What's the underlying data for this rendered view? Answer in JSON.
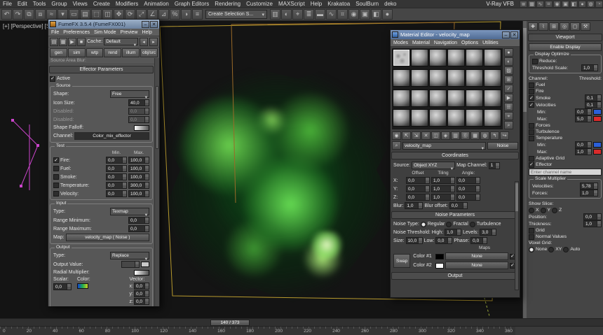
{
  "glyph_note": "icon glyphs are decorative approximations",
  "menu": {
    "items": [
      "File",
      "Edit",
      "Tools",
      "Group",
      "Views",
      "Create",
      "Modifiers",
      "Animation",
      "Graph Editors",
      "Rendering",
      "Customize",
      "MAXScript",
      "Help",
      "Krakatoa",
      "SoulBurn",
      "deko"
    ]
  },
  "vray_label": "V-Ray VFB",
  "top_right_icons": [
    {
      "name": "layer-manager-icon",
      "g": "≣"
    },
    {
      "name": "graphite-tools-icon",
      "g": "▦"
    },
    {
      "name": "curve-editor-icon",
      "g": "∿"
    },
    {
      "name": "schematic-view-icon",
      "g": "⌗"
    },
    {
      "name": "material-editor-icon",
      "g": "◉"
    },
    {
      "name": "render-setup-icon",
      "g": "▣"
    },
    {
      "name": "rendered-frame-window-icon",
      "g": "◧"
    },
    {
      "name": "render-production-icon",
      "g": "●"
    },
    {
      "name": "render-iterative-icon",
      "g": "◍"
    },
    {
      "name": "quick-render-icon",
      "g": "◔"
    }
  ],
  "toolbar": {
    "selection_set_value": "Create Selection S...",
    "icons": [
      {
        "name": "undo-icon",
        "g": "↶"
      },
      {
        "name": "redo-icon",
        "g": "↷"
      },
      {
        "name": "select-and-link-icon",
        "g": "⧉"
      },
      {
        "name": "unlink-selection-icon",
        "g": "⧈"
      },
      {
        "name": "bind-to-space-warp-icon",
        "g": "≈"
      },
      {
        "name": "selection-filter-icon",
        "g": "▾"
      },
      {
        "name": "select-object-icon",
        "g": "▭"
      },
      {
        "name": "select-by-name-icon",
        "g": "▤"
      },
      {
        "name": "selection-region-icon",
        "g": "⬚"
      },
      {
        "name": "window-crossing-icon",
        "g": "◫"
      },
      {
        "name": "select-and-move-icon",
        "g": "✥"
      },
      {
        "name": "select-and-rotate-icon",
        "g": "⟳"
      },
      {
        "name": "select-and-scale-icon",
        "g": "⤢"
      },
      {
        "name": "snaps-toggle-icon",
        "g": "∠"
      },
      {
        "name": "angle-snap-icon",
        "g": "⊿"
      },
      {
        "name": "percent-snap-icon",
        "g": "%"
      },
      {
        "name": "mirror-icon",
        "g": "◑"
      },
      {
        "name": "align-icon",
        "g": "≡"
      }
    ],
    "right_icons": [
      {
        "name": "named-selection-icon",
        "g": "▥"
      },
      {
        "name": "mirror-tool-icon",
        "g": "◐"
      },
      {
        "name": "align-tool-icon",
        "g": "⌖"
      },
      {
        "name": "layer-explorer-icon",
        "g": "≣"
      },
      {
        "name": "toggle-ribbon-icon",
        "g": "▬"
      },
      {
        "name": "curve-editor-toolbar-icon",
        "g": "∿"
      },
      {
        "name": "schematic-view-toolbar-icon",
        "g": "⌗"
      },
      {
        "name": "material-editor-toolbar-icon",
        "g": "◉"
      },
      {
        "name": "render-setup-toolbar-icon",
        "g": "▣"
      },
      {
        "name": "render-frame-icon",
        "g": "◧"
      },
      {
        "name": "render-teapot-icon",
        "g": "●"
      }
    ]
  },
  "viewport": {
    "label": "[+] [Perspective] [Shaded]"
  },
  "fume": {
    "title": "FumeFX 3.5.4 (FumeFX001)",
    "menus": [
      "File",
      "Preferences",
      "Sim Mode",
      "Preview",
      "Help"
    ],
    "tool_icons": [
      {
        "name": "open-icon",
        "g": "▤",
        "style": "background:#4e8f4e;color:#eaffea;"
      },
      {
        "name": "save-icon",
        "g": "▦"
      },
      {
        "name": "start-simulation-icon",
        "g": "▶"
      },
      {
        "name": "stop-simulation-icon",
        "g": "■"
      }
    ],
    "cache_label": "Cache:",
    "cache_value": "Default",
    "tabs": [
      "gen",
      "sim",
      "wtp",
      "rend",
      "illum",
      "obj/src"
    ],
    "clipped_label": "Source Area Blur:",
    "effector_header": "Effector Parameters",
    "active_label": "Active",
    "source": {
      "title": "Source",
      "shape_label": "Shape:",
      "shape_value": "Free",
      "icon_size_label": "Icon Size:",
      "icon_size_value": "40,0",
      "disabled1_label": "Disabled:",
      "disabled1_value": "0,0",
      "disabled2_label": "Disabled:",
      "disabled2_value": "0,0",
      "falloff_label": "Shape Falloff:",
      "channel_label": "Channel:",
      "channel_value": "Color_mix_effector"
    },
    "test": {
      "title": "Test",
      "min_header": "Min.",
      "max_header": "Max.",
      "rows": [
        {
          "label": "Fire:",
          "checked": true,
          "min": "0,0",
          "max": "100,0"
        },
        {
          "label": "Fuel:",
          "min": "0,0",
          "max": "100,0"
        },
        {
          "label": "Smoke:",
          "min": "0,0",
          "max": "100,0"
        },
        {
          "label": "Temperature:",
          "min": "0,0",
          "max": "300,0"
        },
        {
          "label": "Velocity:",
          "min": "0,0",
          "max": "100,0"
        }
      ]
    },
    "input": {
      "title": "Input",
      "type_label": "Type:",
      "type_value": "Texmap",
      "range_min_label": "Range Minimum:",
      "range_min_value": "0,0",
      "range_max_label": "Range Maximum:",
      "range_max_value": "0,0",
      "map_label": "Map:",
      "map_value": "velocity_map ( Noise )"
    },
    "output": {
      "title": "Output",
      "type_label": "Type:",
      "type_value": "Replace",
      "output_value_label": "Output Value:",
      "output_value": "",
      "radial_label": "Radial Multiplier:",
      "scalar_label": "Scalar:",
      "scalar_value": "0,0",
      "color_label": "Color:",
      "vector_label": "Vector:",
      "x_label": "x:",
      "x_value": "0,0",
      "y_label": "y:",
      "y_value": "0,0",
      "z_label": "z:",
      "z_value": "0,0"
    }
  },
  "me": {
    "title": "Material Editor - velocity_map",
    "menus": [
      "Modes",
      "Material",
      "Navigation",
      "Options",
      "Utilities"
    ],
    "slots": [
      {
        "sel": true
      },
      {},
      {},
      {},
      {},
      {},
      {},
      {},
      {},
      {},
      {},
      {},
      {},
      {},
      {},
      {},
      {},
      {},
      {},
      {},
      {},
      {},
      {},
      {}
    ],
    "v_icons": [
      {
        "name": "sample-type-icon",
        "g": "●"
      },
      {
        "name": "backlight-icon",
        "g": "◐"
      },
      {
        "name": "background-icon",
        "g": "▨"
      },
      {
        "name": "sample-uv-tiling-icon",
        "g": "⊞"
      },
      {
        "name": "video-color-check-icon",
        "g": "✓"
      },
      {
        "name": "make-preview-icon",
        "g": "▶"
      },
      {
        "name": "options-icon",
        "g": "☰"
      },
      {
        "name": "select-by-material-icon",
        "g": "⌖"
      },
      {
        "name": "material-map-navigator-icon",
        "g": "⌕"
      }
    ],
    "h_icons": [
      {
        "name": "get-material-icon",
        "g": "◉"
      },
      {
        "name": "put-material-to-scene-icon",
        "g": "⇱"
      },
      {
        "name": "assign-material-icon",
        "g": "⇲"
      },
      {
        "name": "reset-map-icon",
        "g": "✕"
      },
      {
        "name": "make-copy-icon",
        "g": "◫"
      },
      {
        "name": "make-unique-icon",
        "g": "◈"
      },
      {
        "name": "put-to-library-icon",
        "g": "▥"
      },
      {
        "name": "material-id-icon",
        "g": "⓪"
      },
      {
        "name": "show-map-in-viewport-icon",
        "g": "▦"
      },
      {
        "name": "show-end-result-icon",
        "g": "◍"
      },
      {
        "name": "go-to-parent-icon",
        "g": "↰"
      },
      {
        "name": "go-to-sibling-icon",
        "g": "↪"
      }
    ],
    "name_value": "velocity_map",
    "type_button": "Noise",
    "coordinates": {
      "title": "Coordinates",
      "source_label": "Source:",
      "source_value": "Object XYZ",
      "map_channel_label": "Map Channel:",
      "map_channel_value": "1",
      "offset_header": "Offset",
      "tiling_header": "Tiling",
      "angle_header": "Angle:",
      "rows": [
        {
          "label": "X:",
          "offset": "0,0",
          "tiling": "1,0",
          "angle": "0,0"
        },
        {
          "label": "Y:",
          "offset": "0,0",
          "tiling": "1,0",
          "angle": "0,0"
        },
        {
          "label": "Z:",
          "offset": "0,0",
          "tiling": "1,0",
          "angle": "0,0"
        }
      ],
      "blur_label": "Blur:",
      "blur_value": "1,0",
      "blur_offset_label": "Blur offset:",
      "blur_offset_value": "0,0"
    },
    "noise": {
      "title": "Noise Parameters",
      "type_label": "Noise Type:",
      "opt_regular": "Regular",
      "opt_fractal": "Fractal",
      "opt_turbulence": "Turbulence",
      "threshold_label": "Noise Threshold:",
      "high_label": "High:",
      "high_value": "1,0",
      "levels_label": "Levels:",
      "levels_value": "3,0",
      "size_label": "Size:",
      "size_value": "10,0",
      "low_label": "Low:",
      "low_value": "0,0",
      "phase_label": "Phase:",
      "phase_value": "0,0",
      "maps_header": "Maps",
      "swap_label": "Swap",
      "color1_label": "Color #1",
      "color2_label": "Color #2",
      "none1": "None",
      "none2": "None",
      "color1_hex": "#000000",
      "color2_hex": "#ffffff"
    },
    "output_title": "Output"
  },
  "panel": {
    "tabs": [
      {
        "name": "create-tab-icon",
        "g": "✚"
      },
      {
        "name": "modify-tab-icon",
        "g": "⌇"
      },
      {
        "name": "hierarchy-tab-icon",
        "g": "⊞"
      },
      {
        "name": "motion-tab-icon",
        "g": "◎"
      },
      {
        "name": "display-tab-icon",
        "g": "▢"
      },
      {
        "name": "utilities-tab-icon",
        "g": "⚒"
      }
    ],
    "viewport_title": "Viewport",
    "enable_display": "Enable Display",
    "display_optimize_title": "Display Optimize",
    "reduce_label": "Reduce:",
    "threshold_scale_label": "Threshold Scale:",
    "threshold_scale_value": "1,0",
    "channel_header": "Channel:",
    "threshold_header": "Threshold:",
    "channels": [
      {
        "label": "Fuel",
        "box": true
      },
      {
        "label": "Fire",
        "box": true
      },
      {
        "label": "Smoke",
        "box": true,
        "checked": true,
        "value": "0,1"
      },
      {
        "label": "Velocities",
        "box": true,
        "checked": true,
        "value": "0,1"
      },
      {
        "label": "Min:",
        "indent": true,
        "value": "0,0",
        "swatch_blue": true
      },
      {
        "label": "Max:",
        "indent": true,
        "value": "5,0",
        "swatch_red": true
      },
      {
        "label": "Forces",
        "box": true
      },
      {
        "label": "Turbulence",
        "box": true
      },
      {
        "label": "Temperature",
        "box": true
      },
      {
        "label": "Min:",
        "indent": true,
        "value": "0,0",
        "swatch_blue": true
      },
      {
        "label": "Max:",
        "indent": true,
        "value": "1,0",
        "swatch_red": true
      }
    ],
    "adaptive_grid_label": "Adaptive Grid",
    "effector_label": "Effector",
    "effector_field": "Enter channel name",
    "scale": {
      "title": "Scale Multiplier",
      "velocities_label": "Velocities:",
      "velocities_value": "5,78",
      "forces_label": "Forces:",
      "forces_value": "1,0"
    },
    "show_slice_label": "Show Slice:",
    "slice": {
      "x": "X",
      "y": "Y",
      "z": "Z"
    },
    "position_label": "Position:",
    "position_value": "0,0",
    "thickness_label": "Thickness:",
    "thickness_value": "1,0",
    "grid_label": "Grid",
    "normal_values_label": "Normal Values",
    "voxel_label": "Voxel Grid:",
    "voxel": {
      "opt1": "None",
      "opt2": "XY",
      "opt3": "Auto"
    },
    "colors": {
      "velocity_min": "#2b5fd9",
      "velocity_max": "#d92b2b"
    }
  },
  "timeline": {
    "handle": "140 / 373",
    "ticks": [
      "0",
      "20",
      "40",
      "60",
      "80",
      "100",
      "120",
      "140",
      "160",
      "180",
      "200",
      "220",
      "240",
      "260",
      "280",
      "300",
      "320",
      "340",
      "360"
    ]
  }
}
